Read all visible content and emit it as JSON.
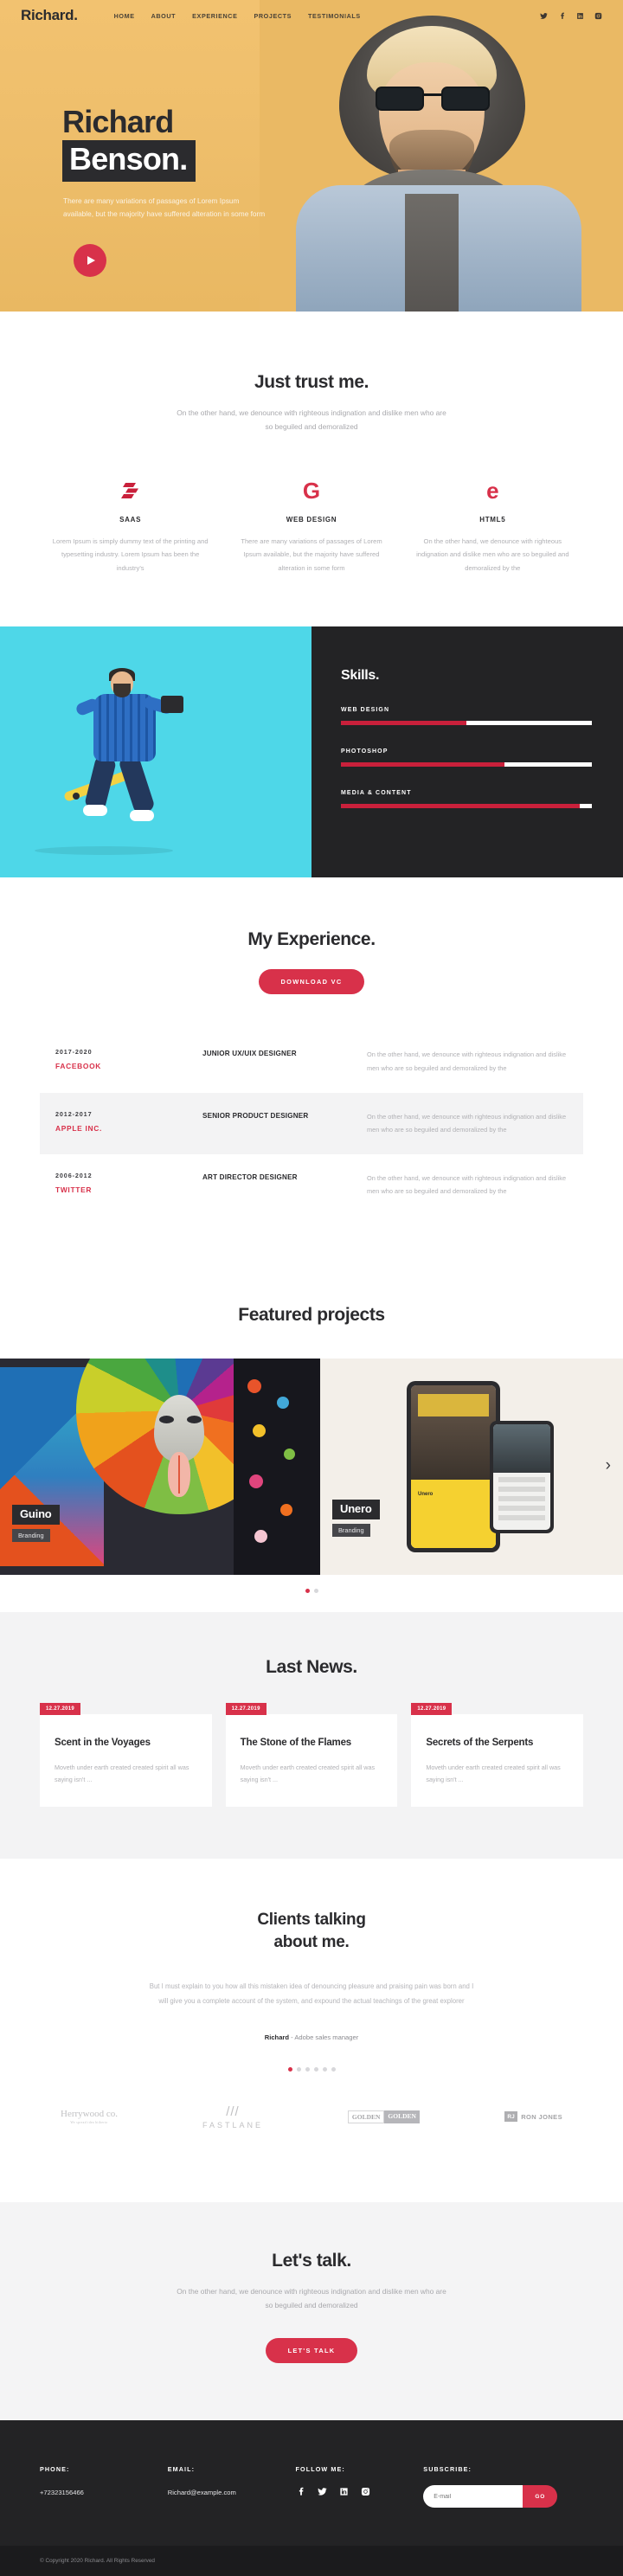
{
  "brand": "Richard.",
  "nav": [
    {
      "label": "HOME"
    },
    {
      "label": "ABOUT"
    },
    {
      "label": "EXPERIENCE"
    },
    {
      "label": "PROJECTS"
    },
    {
      "label": "TESTIMONIALS"
    }
  ],
  "header_social": [
    {
      "name": "twitter-icon"
    },
    {
      "name": "facebook-icon"
    },
    {
      "name": "linkedin-icon"
    },
    {
      "name": "instagram-icon"
    }
  ],
  "hero": {
    "first_name": "Richard",
    "last_name": "Benson.",
    "description": "There are many variations of passages of Lorem Ipsum available, but the majority have suffered alteration in some form",
    "play_icon": "play-icon"
  },
  "trust": {
    "title": "Just trust me.",
    "subtitle": "On the other hand, we denounce with righteous indignation and dislike men who are so beguiled and demoralized",
    "items": [
      {
        "icon": "saas-icon",
        "name": "SAAS",
        "text": "Lorem Ipsum is simply dummy text of the printing and typesetting industry. Lorem Ipsum has been the industry's"
      },
      {
        "icon": "google-g-icon",
        "name": "WEB DESIGN",
        "text": "There are many variations of passages of Lorem Ipsum available, but the majority have suffered alteration in some form"
      },
      {
        "icon": "html5-icon",
        "name": "HTML5",
        "text": "On the other hand, we denounce with righteous indignation and dislike men who are so beguiled and demoralized by the"
      }
    ]
  },
  "skills": {
    "title": "Skills.",
    "items": [
      {
        "label": "WEB DESIGN",
        "value": 50
      },
      {
        "label": "PHOTOSHOP",
        "value": 65
      },
      {
        "label": "MEDIA & CONTENT",
        "value": 95
      }
    ]
  },
  "experience": {
    "title": "My Experience.",
    "download_label": "DOWNLOAD VC",
    "rows": [
      {
        "years": "2017-2020",
        "company": "FACEBOOK",
        "role": "JUNIOR UX/UIX DESIGNER",
        "text": "On the other hand, we denounce with righteous indignation and dislike men who are so beguiled and demoralized by the"
      },
      {
        "years": "2012-2017",
        "company": "APPLE INC.",
        "role": "SENIOR PRODUCT DESIGNER",
        "text": "On the other hand, we denounce with righteous indignation and dislike men who are so beguiled and demoralized by the"
      },
      {
        "years": "2006-2012",
        "company": "TWITTER",
        "role": "ART DIRECTOR DESIGNER",
        "text": "On the other hand, we denounce with righteous indignation and dislike men who are so beguiled and demoralized by the"
      }
    ]
  },
  "projects": {
    "title": "Featured projects",
    "items": [
      {
        "title": "Guino",
        "tag": "Branding"
      },
      {
        "title": "Unero",
        "tag": "Branding"
      }
    ],
    "next_arrow": "chevron-right-icon",
    "dots": 2,
    "active_dot": 0
  },
  "news": {
    "title": "Last News.",
    "cards": [
      {
        "date": "12.27.2019",
        "title": "Scent in the Voyages",
        "text": "Moveth under earth created created spirit all was saying isn't ..."
      },
      {
        "date": "12.27.2019",
        "title": "The Stone of the Flames",
        "text": "Moveth under earth created created spirit all was saying isn't ..."
      },
      {
        "date": "12.27.2019",
        "title": "Secrets of the Serpents",
        "text": "Moveth under earth created created spirit all was saying isn't ..."
      }
    ]
  },
  "testimonials": {
    "title_line1": "Clients talking",
    "title_line2": "about me.",
    "quote": "But I must explain to you how all this mistaken idea of denouncing pleasure and praising pain was born and I will give you a complete account of the system, and expound the actual teachings of the great explorer",
    "author_name": "Richard",
    "author_role": "- Adobe sales manager",
    "dots": 6,
    "active_dot": 0,
    "logos": [
      {
        "name": "herrywood-co-logo",
        "text": "Herrywood co.",
        "sub": "We spread idea hitherto"
      },
      {
        "name": "fastlane-logo",
        "text": "FASTLANE",
        "mark": "///"
      },
      {
        "name": "golden-logo",
        "text1": "GOLDEN",
        "text2": "GOLDEN"
      },
      {
        "name": "ron-jones-logo",
        "initials": "RJ",
        "text": "RON JONES"
      }
    ]
  },
  "talk": {
    "title": "Let's talk.",
    "subtitle": "On the other hand, we denounce with righteous indignation and dislike men who are so beguiled and demoralized",
    "button_label": "LET'S TALK"
  },
  "footer": {
    "phone_label": "PHONE:",
    "phone_value": "+72323156466",
    "email_label": "EMAIL:",
    "email_value": "Richard@example.com",
    "follow_label": "FOLLOW ME:",
    "social": [
      {
        "name": "facebook-icon"
      },
      {
        "name": "twitter-icon"
      },
      {
        "name": "linkedin-icon"
      },
      {
        "name": "instagram-icon"
      }
    ],
    "subscribe_label": "SUBSCRIBE:",
    "email_placeholder": "E-mail",
    "go_label": "GO",
    "copyright": "© Copyright 2020 Richard. All Rights Reserved"
  },
  "colors": {
    "accent_red": "#d8314a",
    "hero_yellow": "#eebe6b",
    "dark": "#232325",
    "muted": "#b0b0b4"
  }
}
